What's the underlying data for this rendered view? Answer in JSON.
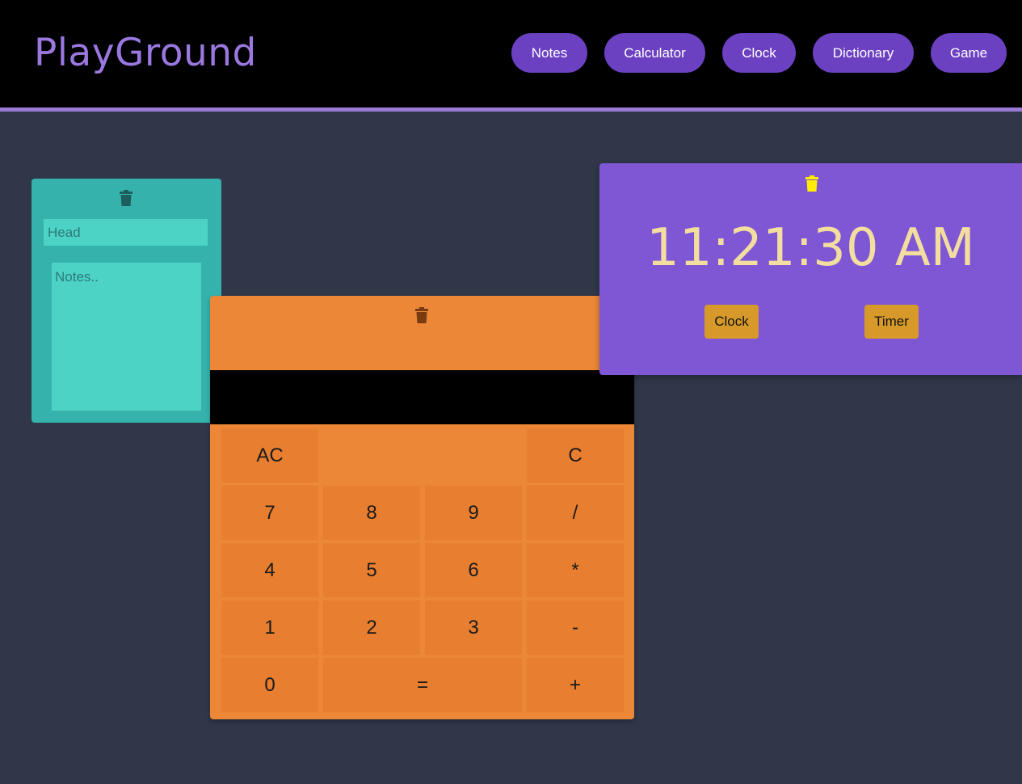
{
  "header": {
    "logo": "PlayGround",
    "nav": [
      {
        "label": "Notes"
      },
      {
        "label": "Calculator"
      },
      {
        "label": "Clock"
      },
      {
        "label": "Dictionary"
      },
      {
        "label": "Game"
      }
    ]
  },
  "notes": {
    "delete_icon": "trash-icon",
    "head_placeholder": "Head",
    "body_placeholder": "Notes.."
  },
  "calculator": {
    "delete_icon": "trash-icon",
    "display_value": "",
    "keys": {
      "ac": "AC",
      "c": "C",
      "k7": "7",
      "k8": "8",
      "k9": "9",
      "div": "/",
      "k4": "4",
      "k5": "5",
      "k6": "6",
      "mul": "*",
      "k1": "1",
      "k2": "2",
      "k3": "3",
      "sub": "-",
      "k0": "0",
      "eq": "=",
      "add": "+"
    }
  },
  "clock": {
    "delete_icon": "trash-icon",
    "time": "11:21:30 AM",
    "clock_button": "Clock",
    "timer_button": "Timer"
  },
  "colors": {
    "background": "#2f3749",
    "accent": "#6b41c2",
    "notes_bg": "#35b2ac",
    "calculator_bg": "#eb8736",
    "clock_bg": "#7f57d4"
  }
}
